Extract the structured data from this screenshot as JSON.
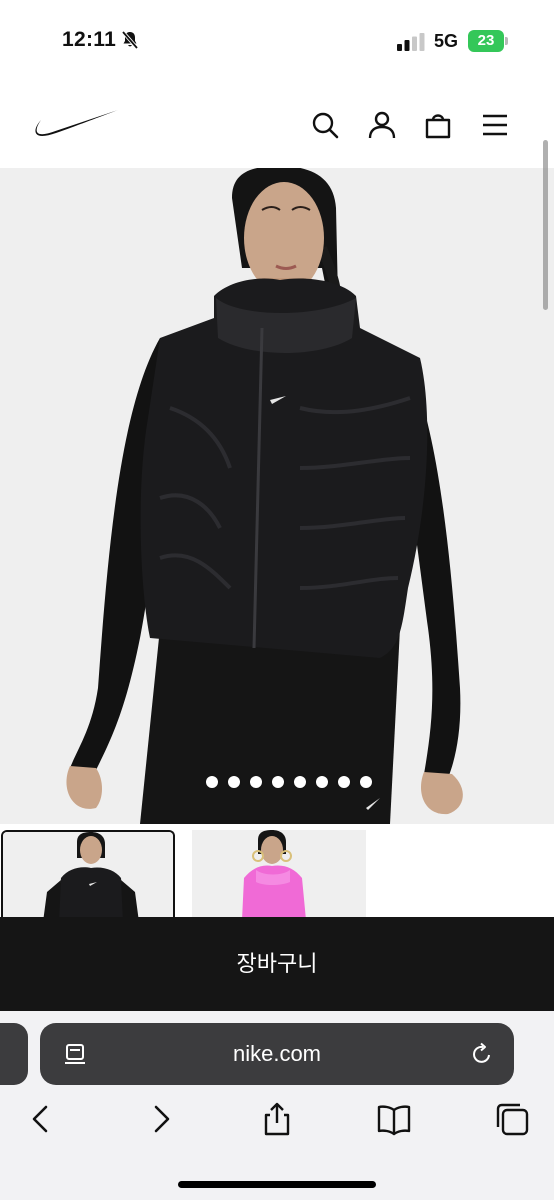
{
  "status_bar": {
    "time": "12:11",
    "network": "5G",
    "battery_level": "23",
    "icons": [
      "bell-slash-icon",
      "signal-bars-icon",
      "battery-charging-icon"
    ]
  },
  "header": {
    "logo": "nike-swoosh-logo",
    "icons": [
      "search-icon",
      "user-icon",
      "bag-icon",
      "menu-icon"
    ]
  },
  "gallery": {
    "dot_count": 8,
    "thumbnails": [
      "black vest",
      "pink vest"
    ]
  },
  "cart": {
    "label": "장바구니"
  },
  "browser": {
    "url": "nike.com",
    "toolbar_icons": [
      "back-icon",
      "forward-icon",
      "share-icon",
      "bookmarks-icon",
      "tabs-icon"
    ]
  },
  "colors": {
    "cart_bar": "#151515",
    "url_bar": "#3c3c3e",
    "battery": "#34c759",
    "hero_bg": "#efefef"
  }
}
